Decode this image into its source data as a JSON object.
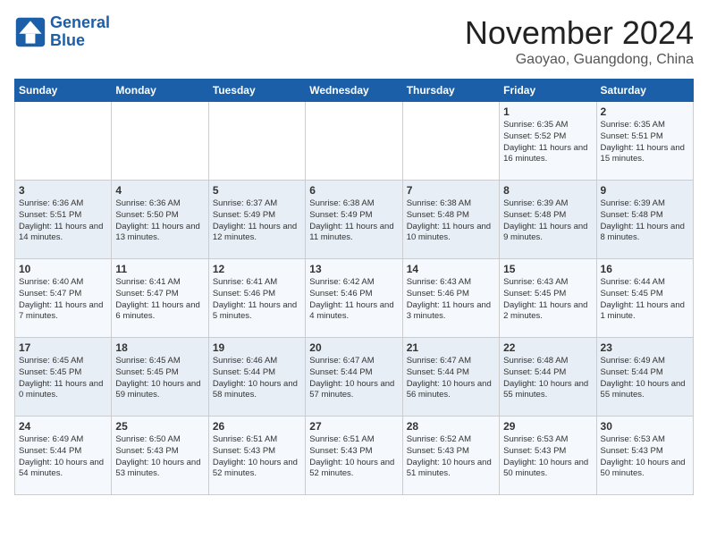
{
  "header": {
    "logo_line1": "General",
    "logo_line2": "Blue",
    "title": "November 2024",
    "subtitle": "Gaoyao, Guangdong, China"
  },
  "days_of_week": [
    "Sunday",
    "Monday",
    "Tuesday",
    "Wednesday",
    "Thursday",
    "Friday",
    "Saturday"
  ],
  "weeks": [
    [
      {
        "day": "",
        "info": ""
      },
      {
        "day": "",
        "info": ""
      },
      {
        "day": "",
        "info": ""
      },
      {
        "day": "",
        "info": ""
      },
      {
        "day": "",
        "info": ""
      },
      {
        "day": "1",
        "info": "Sunrise: 6:35 AM\nSunset: 5:52 PM\nDaylight: 11 hours and 16 minutes."
      },
      {
        "day": "2",
        "info": "Sunrise: 6:35 AM\nSunset: 5:51 PM\nDaylight: 11 hours and 15 minutes."
      }
    ],
    [
      {
        "day": "3",
        "info": "Sunrise: 6:36 AM\nSunset: 5:51 PM\nDaylight: 11 hours and 14 minutes."
      },
      {
        "day": "4",
        "info": "Sunrise: 6:36 AM\nSunset: 5:50 PM\nDaylight: 11 hours and 13 minutes."
      },
      {
        "day": "5",
        "info": "Sunrise: 6:37 AM\nSunset: 5:49 PM\nDaylight: 11 hours and 12 minutes."
      },
      {
        "day": "6",
        "info": "Sunrise: 6:38 AM\nSunset: 5:49 PM\nDaylight: 11 hours and 11 minutes."
      },
      {
        "day": "7",
        "info": "Sunrise: 6:38 AM\nSunset: 5:48 PM\nDaylight: 11 hours and 10 minutes."
      },
      {
        "day": "8",
        "info": "Sunrise: 6:39 AM\nSunset: 5:48 PM\nDaylight: 11 hours and 9 minutes."
      },
      {
        "day": "9",
        "info": "Sunrise: 6:39 AM\nSunset: 5:48 PM\nDaylight: 11 hours and 8 minutes."
      }
    ],
    [
      {
        "day": "10",
        "info": "Sunrise: 6:40 AM\nSunset: 5:47 PM\nDaylight: 11 hours and 7 minutes."
      },
      {
        "day": "11",
        "info": "Sunrise: 6:41 AM\nSunset: 5:47 PM\nDaylight: 11 hours and 6 minutes."
      },
      {
        "day": "12",
        "info": "Sunrise: 6:41 AM\nSunset: 5:46 PM\nDaylight: 11 hours and 5 minutes."
      },
      {
        "day": "13",
        "info": "Sunrise: 6:42 AM\nSunset: 5:46 PM\nDaylight: 11 hours and 4 minutes."
      },
      {
        "day": "14",
        "info": "Sunrise: 6:43 AM\nSunset: 5:46 PM\nDaylight: 11 hours and 3 minutes."
      },
      {
        "day": "15",
        "info": "Sunrise: 6:43 AM\nSunset: 5:45 PM\nDaylight: 11 hours and 2 minutes."
      },
      {
        "day": "16",
        "info": "Sunrise: 6:44 AM\nSunset: 5:45 PM\nDaylight: 11 hours and 1 minute."
      }
    ],
    [
      {
        "day": "17",
        "info": "Sunrise: 6:45 AM\nSunset: 5:45 PM\nDaylight: 11 hours and 0 minutes."
      },
      {
        "day": "18",
        "info": "Sunrise: 6:45 AM\nSunset: 5:45 PM\nDaylight: 10 hours and 59 minutes."
      },
      {
        "day": "19",
        "info": "Sunrise: 6:46 AM\nSunset: 5:44 PM\nDaylight: 10 hours and 58 minutes."
      },
      {
        "day": "20",
        "info": "Sunrise: 6:47 AM\nSunset: 5:44 PM\nDaylight: 10 hours and 57 minutes."
      },
      {
        "day": "21",
        "info": "Sunrise: 6:47 AM\nSunset: 5:44 PM\nDaylight: 10 hours and 56 minutes."
      },
      {
        "day": "22",
        "info": "Sunrise: 6:48 AM\nSunset: 5:44 PM\nDaylight: 10 hours and 55 minutes."
      },
      {
        "day": "23",
        "info": "Sunrise: 6:49 AM\nSunset: 5:44 PM\nDaylight: 10 hours and 55 minutes."
      }
    ],
    [
      {
        "day": "24",
        "info": "Sunrise: 6:49 AM\nSunset: 5:44 PM\nDaylight: 10 hours and 54 minutes."
      },
      {
        "day": "25",
        "info": "Sunrise: 6:50 AM\nSunset: 5:43 PM\nDaylight: 10 hours and 53 minutes."
      },
      {
        "day": "26",
        "info": "Sunrise: 6:51 AM\nSunset: 5:43 PM\nDaylight: 10 hours and 52 minutes."
      },
      {
        "day": "27",
        "info": "Sunrise: 6:51 AM\nSunset: 5:43 PM\nDaylight: 10 hours and 52 minutes."
      },
      {
        "day": "28",
        "info": "Sunrise: 6:52 AM\nSunset: 5:43 PM\nDaylight: 10 hours and 51 minutes."
      },
      {
        "day": "29",
        "info": "Sunrise: 6:53 AM\nSunset: 5:43 PM\nDaylight: 10 hours and 50 minutes."
      },
      {
        "day": "30",
        "info": "Sunrise: 6:53 AM\nSunset: 5:43 PM\nDaylight: 10 hours and 50 minutes."
      }
    ]
  ]
}
